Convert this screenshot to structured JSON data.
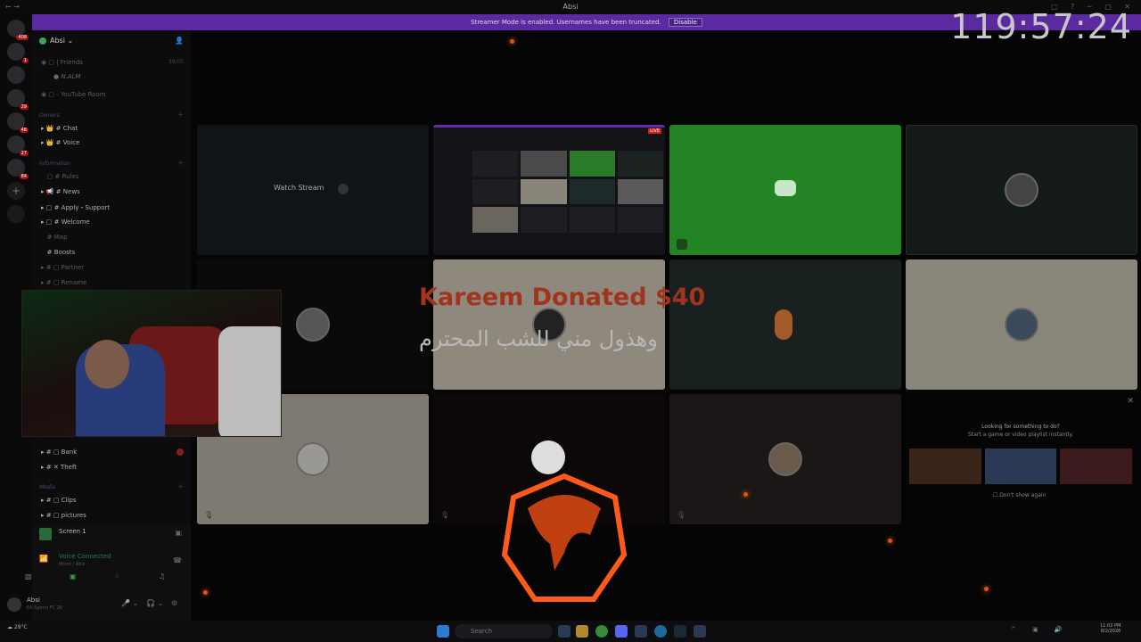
{
  "window": {
    "title": "Absi"
  },
  "banner": {
    "text": "Streamer Mode is enabled. Usernames have been truncated.",
    "button": "Disable"
  },
  "overlay": {
    "timer": "119:57:24",
    "donation": "Kareem Donated $40",
    "message": "وهذول مني للشب المحترم"
  },
  "rail": {
    "badges": [
      "408",
      "1",
      "29",
      "48",
      "27",
      "84"
    ]
  },
  "server": {
    "name": "Absi"
  },
  "channels": {
    "friends": "Friends",
    "friends_count": "39/05",
    "friend_user": "N.ALM",
    "youtube": "YouTube Room",
    "cat_owners": "Owners",
    "chat": "Chat",
    "voice": "Voice",
    "cat_information": "Information",
    "rules": "Rules",
    "news": "News",
    "apply": "Apply・Support",
    "welcome": "Welcome",
    "map": "Map",
    "boosts": "Boosts",
    "partner": "Partner",
    "rename": "Rename",
    "bank": "Bank",
    "theft": "Theft",
    "cat_media": "Media",
    "clips": "Clips",
    "pictures": "pictures"
  },
  "stream_panel": {
    "screen": "Screen 1",
    "voice_status": "Voice Connected",
    "voice_sub": "Mnori / Absi"
  },
  "user": {
    "name": "Absi",
    "status": "EA Sports FC 26"
  },
  "grid": {
    "watch_stream": "Watch Stream",
    "live": "LIVE"
  },
  "popup": {
    "title": "Looking for something to do?",
    "subtitle": "Start a game or video playlist instantly.",
    "dont_show": "Don't show again"
  },
  "taskbar": {
    "weather": "28°C",
    "search": "Search",
    "time": "11:02 PM",
    "date": "8/2/2026"
  },
  "colors": {
    "banner": "#5b2aa0",
    "green_tile": "#2a8a2a",
    "donation": "#a0341d"
  }
}
